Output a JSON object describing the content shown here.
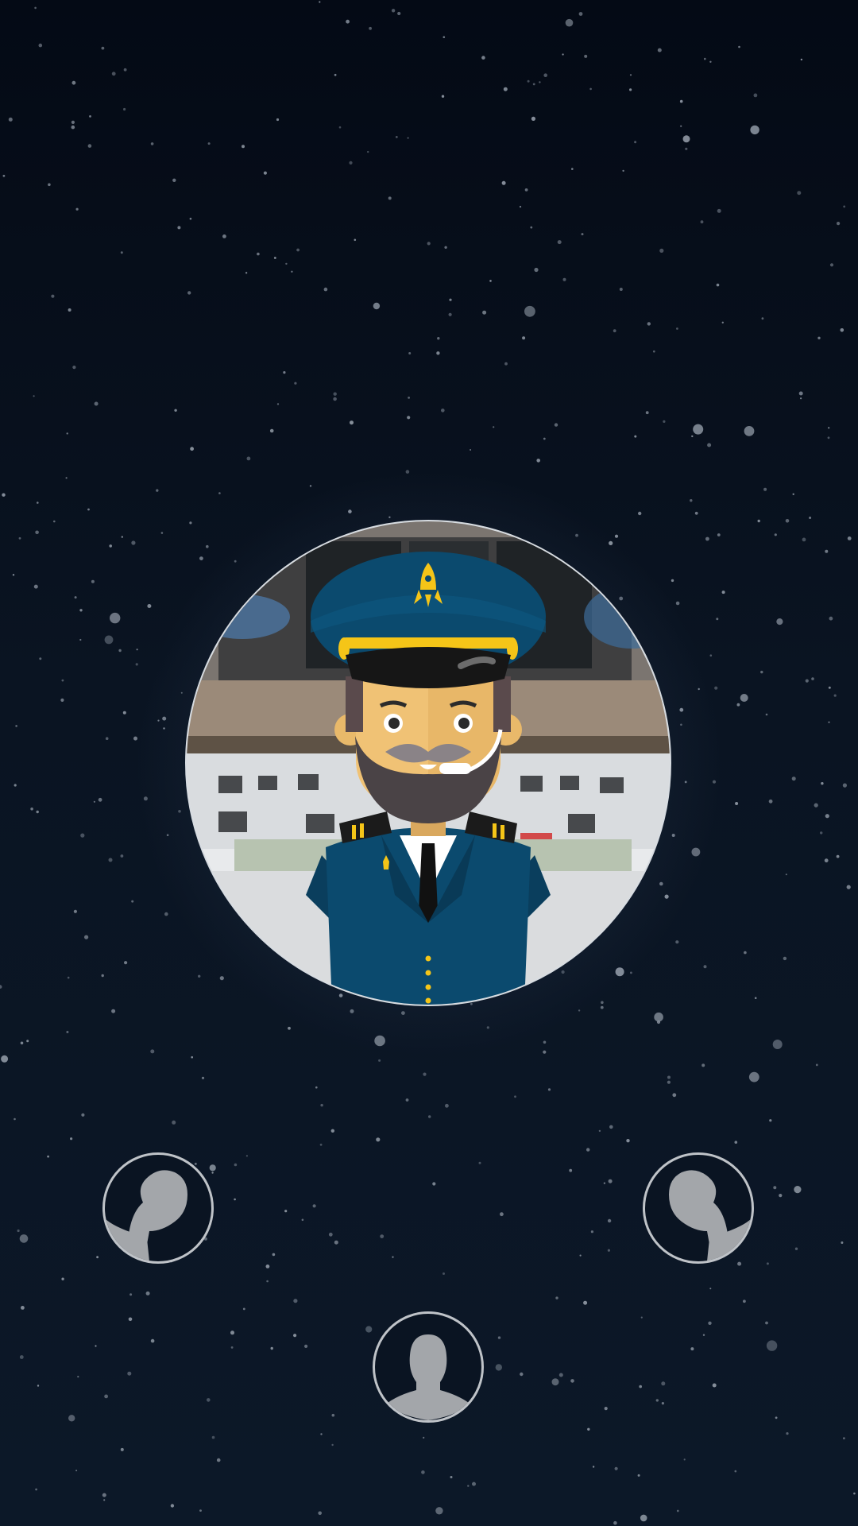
{
  "screen": {
    "name": "crew-selection",
    "background_top": "#040a15",
    "background_bottom": "#0c1828",
    "star_color": "#8d96a2"
  },
  "main_avatar": {
    "icon": "captain-avatar-icon",
    "hat_color": "#0b4a6e",
    "hat_band_color": "#f5c518",
    "uniform_color": "#0b4a6e",
    "skin_color": "#f0c275",
    "beard_color": "#4a4346"
  },
  "crew_slots": [
    {
      "id": "left",
      "icon": "person-silhouette-icon",
      "facing": "left",
      "color": "#a3a6aa"
    },
    {
      "id": "right",
      "icon": "person-silhouette-icon",
      "facing": "right",
      "color": "#a3a6aa"
    },
    {
      "id": "bottom",
      "icon": "person-silhouette-icon",
      "facing": "front",
      "color": "#a3a6aa"
    }
  ]
}
